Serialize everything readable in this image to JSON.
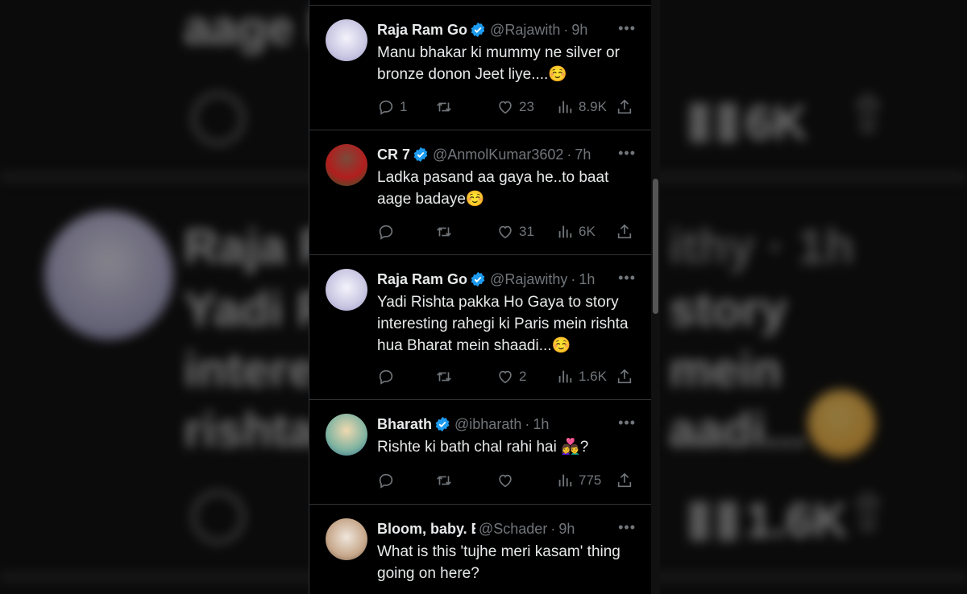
{
  "tweets": [
    {
      "name": "Raja Ram Go",
      "handle": "@Rajawith",
      "time": "9h",
      "text": "Manu bhakar ki mummy ne silver or bronze donon Jeet liye....",
      "emoji": "☺️",
      "replies": "1",
      "retweets": "",
      "likes": "23",
      "views": "8.9K"
    },
    {
      "name": "CR 7",
      "handle": "@AnmolKumar3602",
      "time": "7h",
      "text": "Ladka pasand aa gaya he..to baat aage badaye",
      "emoji": "☺️",
      "replies": "",
      "retweets": "",
      "likes": "31",
      "views": "6K"
    },
    {
      "name": "Raja Ram Go",
      "handle": "@Rajawithy",
      "time": "1h",
      "text": "Yadi Rishta pakka Ho Gaya to story interesting rahegi ki Paris mein rishta hua Bharat mein shaadi...",
      "emoji": "☺️",
      "replies": "",
      "retweets": "",
      "likes": "2",
      "views": "1.6K"
    },
    {
      "name": "Bharath",
      "handle": "@ibharath",
      "time": "1h",
      "text": "Rishte ki bath chal rahi hai ",
      "emoji": "👩‍❤️‍👨?",
      "replies": "",
      "retweets": "",
      "likes": "",
      "views": "775"
    },
    {
      "name": "Bloom, baby. Blo",
      "handle": "@Schader",
      "time": "9h",
      "text": "What is this 'tujhe meri kasam' thing going on here?",
      "emoji": ""
    }
  ],
  "background": {
    "blur_name": "Raja R",
    "blur_line1": "Yadi R",
    "blur_line2": "intere",
    "blur_line3": "rishta",
    "blur_right1": "aadi...",
    "blur_right2": "story",
    "blur_right3": "mein",
    "blur_top": "aage b",
    "blur_views_top": "6K",
    "blur_views_bottom": "1.6K",
    "blur_handle": "ithy · 1h"
  },
  "colors": {
    "accent_blue": "#1d9bf0",
    "text_primary": "#e7e9ea",
    "text_secondary": "#71767b",
    "border": "#2f3336"
  }
}
